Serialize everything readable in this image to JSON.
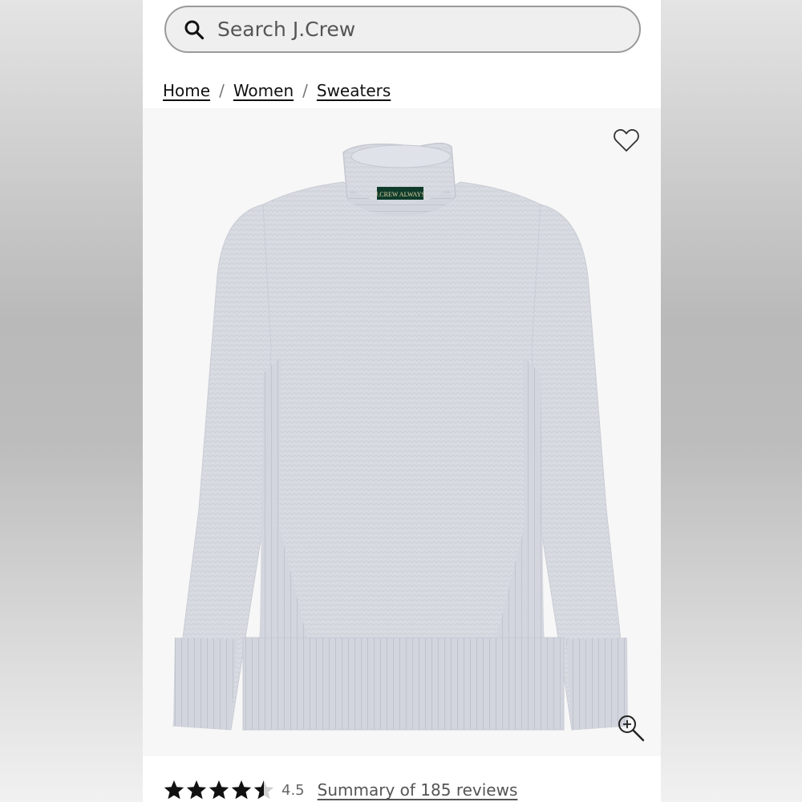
{
  "search": {
    "placeholder": "Search J.Crew",
    "icon": "search-icon"
  },
  "breadcrumb": {
    "items": [
      "Home",
      "Women",
      "Sweaters"
    ],
    "separator": "/"
  },
  "product": {
    "label_text": "J.CREW ALWAYS",
    "wishlist_icon": "heart-outline-icon",
    "zoom_icon": "zoom-in-icon",
    "sweater_color": "#d9dce3"
  },
  "rating": {
    "value": "4.5",
    "stars_filled": 4.5,
    "stars_total": 5,
    "reviews_link": "Summary of 185 reviews"
  }
}
